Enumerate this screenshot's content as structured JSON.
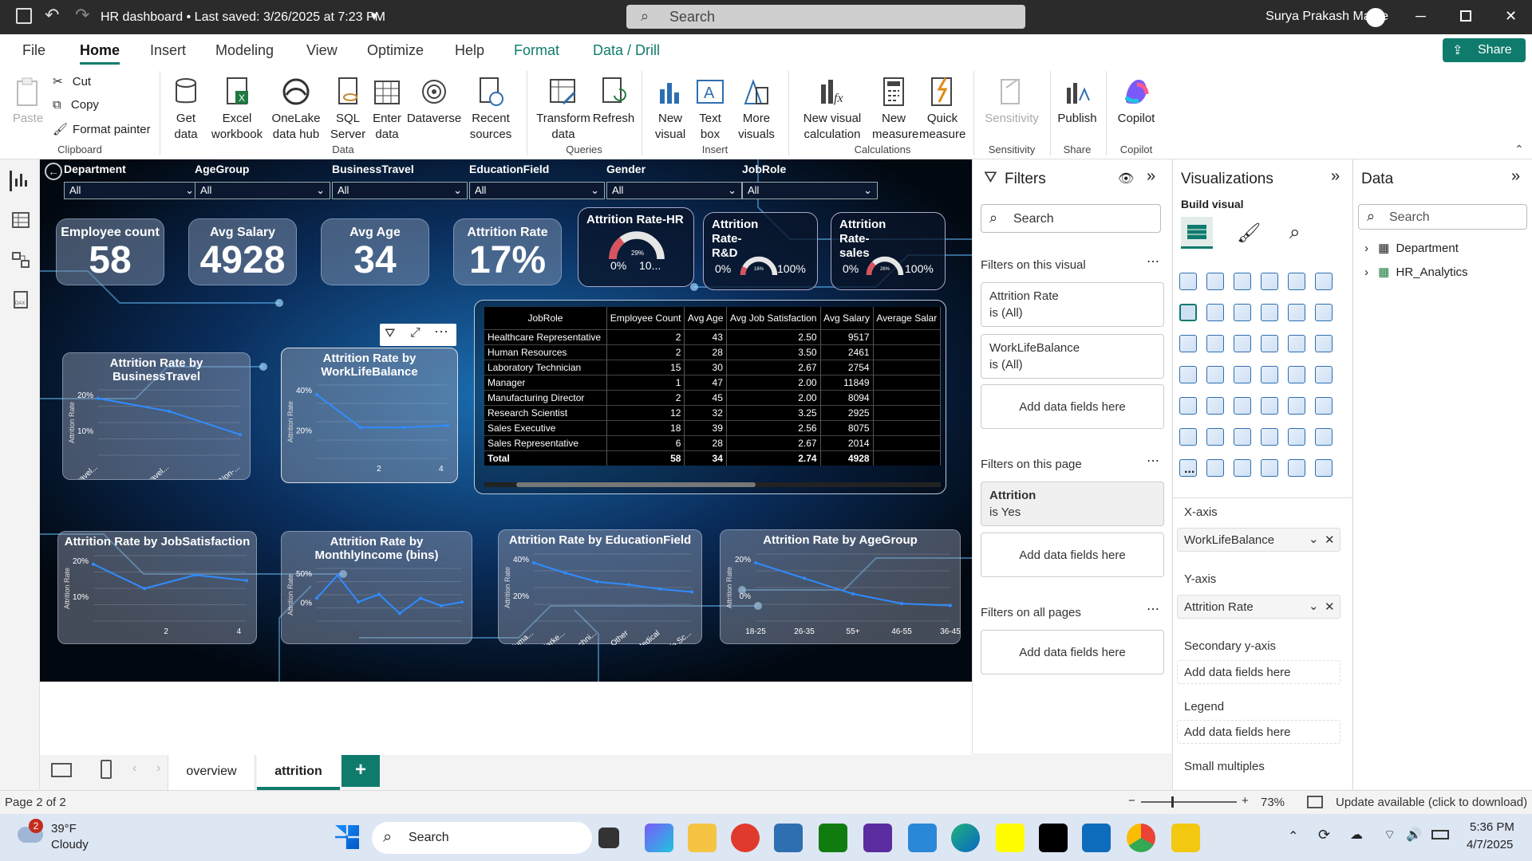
{
  "titlebar": {
    "title": "HR dashboard • Last saved: 3/26/2025 at 7:23 PM",
    "search": "Search",
    "user": "Surya Prakash Mathe"
  },
  "menu": [
    "File",
    "Home",
    "Insert",
    "Modeling",
    "View",
    "Optimize",
    "Help",
    "Format",
    "Data / Drill"
  ],
  "share": "Share",
  "ribbon": {
    "clipboard": {
      "paste": "Paste",
      "cut": "Cut",
      "copy": "Copy",
      "format_painter": "Format painter",
      "group": "Clipboard"
    },
    "data": {
      "get_data": "Get data",
      "excel": "Excel workbook",
      "onelake": "OneLake data hub",
      "sql": "SQL Server",
      "enter": "Enter data",
      "dataverse": "Dataverse",
      "recent": "Recent sources",
      "group": "Data"
    },
    "queries": {
      "transform": "Transform data",
      "refresh": "Refresh",
      "group": "Queries"
    },
    "insert": {
      "new_visual": "New visual",
      "text_box": "Text box",
      "more_visuals": "More visuals",
      "group": "Insert"
    },
    "calculations": {
      "new_calc": "New visual calculation",
      "new_measure": "New measure",
      "quick_measure": "Quick measure",
      "group": "Calculations"
    },
    "sensitivity": {
      "btn": "Sensitivity",
      "group": "Sensitivity"
    },
    "share": {
      "publish": "Publish",
      "group": "Share"
    },
    "copilot": {
      "btn": "Copilot",
      "group": "Copilot"
    }
  },
  "slicers": [
    {
      "label": "Department",
      "value": "All"
    },
    {
      "label": "AgeGroup",
      "value": "All"
    },
    {
      "label": "BusinessTravel",
      "value": "All"
    },
    {
      "label": "EducationField",
      "value": "All"
    },
    {
      "label": "Gender",
      "value": "All"
    },
    {
      "label": "JobRole",
      "value": "All"
    }
  ],
  "kpis": [
    {
      "title": "Employee count",
      "value": "58"
    },
    {
      "title": "Avg Salary",
      "value": "4928"
    },
    {
      "title": "Avg Age",
      "value": "34"
    },
    {
      "title": "Attrition Rate",
      "value": "17%"
    }
  ],
  "gauges": [
    {
      "title": "Attrition Rate-HR",
      "min": "0%",
      "max": "10...",
      "value": "29%",
      "fraction": 0.29
    },
    {
      "title": "Attrition Rate-R&D",
      "min": "0%",
      "max": "100%",
      "value": "16%",
      "fraction": 0.16
    },
    {
      "title": "Attrition Rate-sales",
      "min": "0%",
      "max": "100%",
      "value": "26%",
      "fraction": 0.26
    }
  ],
  "table": {
    "headers": [
      "JobRole",
      "Employee Count",
      "Avg Age",
      "Avg Job Satisfaction",
      "Avg Salary",
      "Average Salar"
    ],
    "rows": [
      [
        "Healthcare Representative",
        "2",
        "43",
        "2.50",
        "9517",
        ""
      ],
      [
        "Human Resources",
        "2",
        "28",
        "3.50",
        "2461",
        ""
      ],
      [
        "Laboratory Technician",
        "15",
        "30",
        "2.67",
        "2754",
        ""
      ],
      [
        "Manager",
        "1",
        "47",
        "2.00",
        "11849",
        ""
      ],
      [
        "Manufacturing Director",
        "2",
        "45",
        "2.00",
        "8094",
        ""
      ],
      [
        "Research Scientist",
        "12",
        "32",
        "3.25",
        "2925",
        ""
      ],
      [
        "Sales Executive",
        "18",
        "39",
        "2.56",
        "8075",
        ""
      ],
      [
        "Sales Representative",
        "6",
        "28",
        "2.67",
        "2014",
        ""
      ]
    ],
    "total": [
      "Total",
      "58",
      "34",
      "2.74",
      "4928",
      ""
    ]
  },
  "chart_data": [
    {
      "type": "line",
      "title": "Attrition Rate by BusinessTravel",
      "ylabel": "Attrition Rate",
      "x": [
        "Travel...",
        "Travel...",
        "Non-..."
      ],
      "yticks": [
        "20%",
        "10%"
      ],
      "values": [
        0.22,
        0.17,
        0.08
      ]
    },
    {
      "type": "line",
      "title": "Attrition Rate by WorkLifeBalance",
      "ylabel": "Attrition Rate",
      "x": [
        1,
        2,
        3,
        4
      ],
      "xticks": [
        "2",
        "4"
      ],
      "yticks": [
        "40%",
        "20%"
      ],
      "values": [
        0.33,
        0.16,
        0.16,
        0.17
      ]
    },
    {
      "type": "line",
      "title": "Attrition Rate by JobSatisfaction",
      "ylabel": "Attrition Rate",
      "x": [
        1,
        2,
        3,
        4
      ],
      "xticks": [
        "2",
        "4"
      ],
      "yticks": [
        "20%",
        "10%"
      ],
      "values": [
        0.21,
        0.12,
        0.17,
        0.15
      ]
    },
    {
      "type": "line",
      "title": "Attrition Rate by MonthlyIncome (bins)",
      "ylabel": "Attrition Rate",
      "yticks": [
        "50%",
        "0%"
      ],
      "values": [
        0.3,
        0.6,
        0.25,
        0.35,
        0.1,
        0.3,
        0.2,
        0.25
      ]
    },
    {
      "type": "line",
      "title": "Attrition Rate by EducationField",
      "ylabel": "Attrition Rate",
      "x": [
        "Huma...",
        "Marke...",
        "Techni...",
        "Other",
        "Medical",
        "Life Sc..."
      ],
      "yticks": [
        "40%",
        "20%"
      ],
      "values": [
        0.4,
        0.33,
        0.27,
        0.25,
        0.22,
        0.2
      ]
    },
    {
      "type": "line",
      "title": "Attrition Rate by AgeGroup",
      "ylabel": "Attrition Rate",
      "x": [
        "18-25",
        "26-35",
        "55+",
        "46-55",
        "36-45"
      ],
      "yticks": [
        "20%",
        "0%"
      ],
      "values": [
        0.3,
        0.22,
        0.14,
        0.09,
        0.08
      ]
    }
  ],
  "filters": {
    "title": "Filters",
    "search": "Search",
    "on_visual": "Filters on this visual",
    "visual_cards": [
      {
        "name": "Attrition Rate",
        "state": "is (All)"
      },
      {
        "name": "WorkLifeBalance",
        "state": "is (All)"
      }
    ],
    "add": "Add data fields here",
    "on_page": "Filters on this page",
    "page_card": {
      "name": "Attrition",
      "state": "is Yes"
    },
    "on_all": "Filters on all pages"
  },
  "viz": {
    "title": "Visualizations",
    "build": "Build visual",
    "xaxis": "X-axis",
    "xaxis_field": "WorkLifeBalance",
    "yaxis": "Y-axis",
    "yaxis_field": "Attrition Rate",
    "secondary": "Secondary y-axis",
    "legend": "Legend",
    "small": "Small multiples",
    "add": "Add data fields here",
    "more": "..."
  },
  "data_pane": {
    "title": "Data",
    "search": "Search",
    "tables": [
      "Department",
      "HR_Analytics"
    ]
  },
  "tabs": {
    "pages": [
      "overview",
      "attrition"
    ],
    "add": "+"
  },
  "status": {
    "page": "Page 2 of 2",
    "zoom": "73%",
    "update": "Update available (click to download)"
  },
  "taskbar": {
    "temp": "39°F",
    "weather": "Cloudy",
    "badge": "2",
    "search": "Search",
    "time": "5:36 PM",
    "date": "4/7/2025"
  }
}
